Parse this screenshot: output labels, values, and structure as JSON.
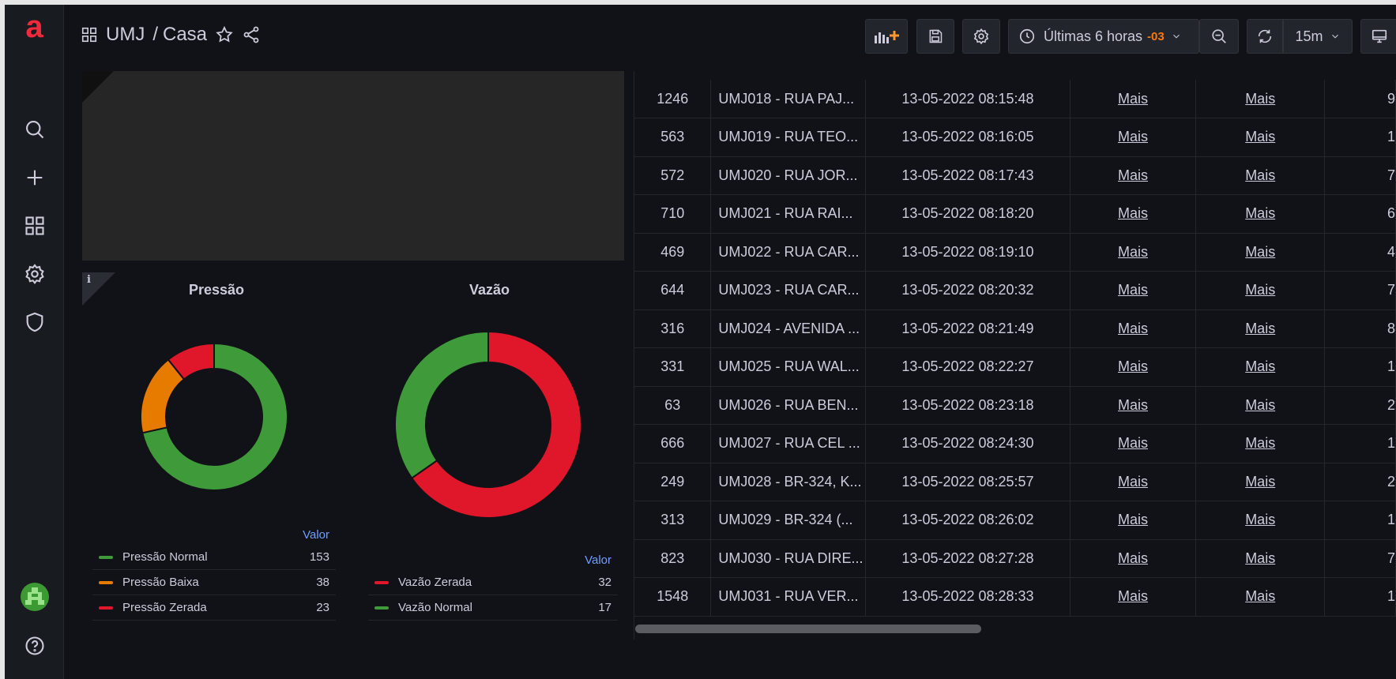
{
  "app": {
    "logo_letter": "a"
  },
  "breadcrumb": {
    "folder": "UMJ",
    "separator": "/",
    "dashboard": "Casa"
  },
  "toolbar": {
    "time_range": "Últimas 6 horas",
    "timezone": "-03",
    "refresh_interval": "15m"
  },
  "sidebar": {
    "items": [
      {
        "name": "search-icon"
      },
      {
        "name": "plus-icon"
      },
      {
        "name": "dashboards-icon"
      },
      {
        "name": "gear-icon"
      },
      {
        "name": "shield-icon"
      },
      {
        "name": "help-icon"
      }
    ]
  },
  "pressao": {
    "title": "Pressão",
    "value_header": "Valor",
    "items": [
      {
        "label": "Pressão Normal",
        "value": 153,
        "color": "#3f9a3a"
      },
      {
        "label": "Pressão Baixa",
        "value": 38,
        "color": "#e67b00"
      },
      {
        "label": "Pressão Zerada",
        "value": 23,
        "color": "#e0162b"
      }
    ]
  },
  "vazao": {
    "title": "Vazão",
    "value_header": "Valor",
    "items": [
      {
        "label": "Vazão Zerada",
        "value": 32,
        "color": "#e0162b"
      },
      {
        "label": "Vazão Normal",
        "value": 17,
        "color": "#3f9a3a"
      }
    ]
  },
  "table": {
    "link_text": "Mais",
    "rows": [
      {
        "id": "1246",
        "name": "UMJ018 - RUA PAJ...",
        "date": "13-05-2022 08:15:48",
        "tail": "9"
      },
      {
        "id": "563",
        "name": "UMJ019 - RUA TEO...",
        "date": "13-05-2022 08:16:05",
        "tail": "1"
      },
      {
        "id": "572",
        "name": "UMJ020 - RUA JOR...",
        "date": "13-05-2022 08:17:43",
        "tail": "7"
      },
      {
        "id": "710",
        "name": "UMJ021 - RUA RAI...",
        "date": "13-05-2022 08:18:20",
        "tail": "6"
      },
      {
        "id": "469",
        "name": "UMJ022 - RUA CAR...",
        "date": "13-05-2022 08:19:10",
        "tail": "4"
      },
      {
        "id": "644",
        "name": "UMJ023 - RUA CAR...",
        "date": "13-05-2022 08:20:32",
        "tail": "7"
      },
      {
        "id": "316",
        "name": "UMJ024 - AVENIDA ...",
        "date": "13-05-2022 08:21:49",
        "tail": "8"
      },
      {
        "id": "331",
        "name": "UMJ025 - RUA WAL...",
        "date": "13-05-2022 08:22:27",
        "tail": "1"
      },
      {
        "id": "63",
        "name": "UMJ026 - RUA BEN...",
        "date": "13-05-2022 08:23:18",
        "tail": "2"
      },
      {
        "id": "666",
        "name": "UMJ027 - RUA CEL ...",
        "date": "13-05-2022 08:24:30",
        "tail": "1"
      },
      {
        "id": "249",
        "name": "UMJ028 - BR-324, K...",
        "date": "13-05-2022 08:25:57",
        "tail": "2"
      },
      {
        "id": "313",
        "name": "UMJ029 - BR-324 (...",
        "date": "13-05-2022 08:26:02",
        "tail": "1"
      },
      {
        "id": "823",
        "name": "UMJ030 - RUA DIRE...",
        "date": "13-05-2022 08:27:28",
        "tail": "7"
      },
      {
        "id": "1548",
        "name": "UMJ031 - RUA VER...",
        "date": "13-05-2022 08:28:33",
        "tail": "1"
      }
    ]
  }
}
